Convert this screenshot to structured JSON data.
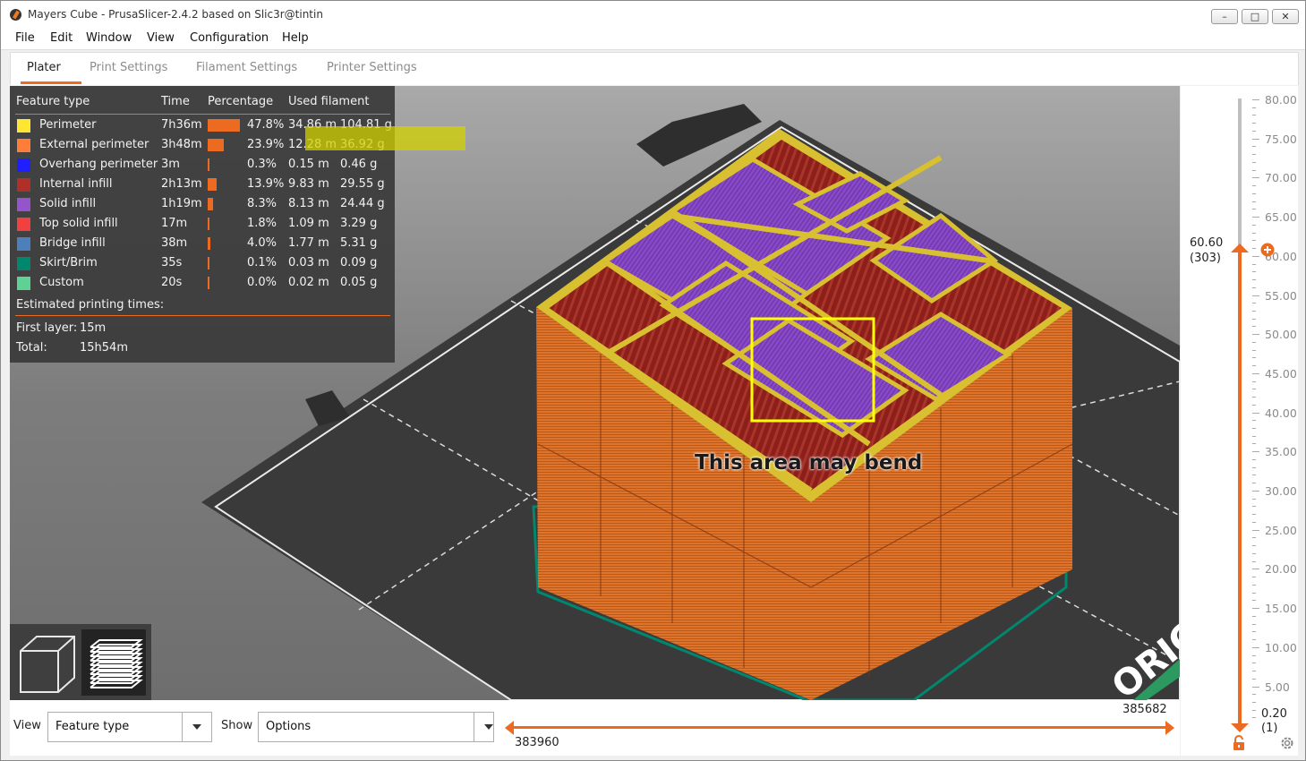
{
  "window": {
    "title": "Mayers Cube - PrusaSlicer-2.4.2 based on Slic3r@tintin",
    "minimize_glyph": "–",
    "maximize_glyph": "□",
    "close_glyph": "✕"
  },
  "menu": [
    "File",
    "Edit",
    "Window",
    "View",
    "Configuration",
    "Help"
  ],
  "tabs": [
    "Plater",
    "Print Settings",
    "Filament Settings",
    "Printer Settings"
  ],
  "legend": {
    "headers": [
      "Feature type",
      "Time",
      "Percentage",
      "Used filament"
    ],
    "rows": [
      {
        "name": "Perimeter",
        "color": "#ffe633",
        "time": "7h36m",
        "pct": "47.8%",
        "pct_value": 47.8,
        "len": "34.86 m",
        "weight": "104.81 g"
      },
      {
        "name": "External perimeter",
        "color": "#ff7d38",
        "time": "3h48m",
        "pct": "23.9%",
        "pct_value": 23.9,
        "len": "12.28 m",
        "weight": "36.92 g"
      },
      {
        "name": "Overhang perimeter",
        "color": "#1f1fff",
        "time": "3m",
        "pct": "0.3%",
        "pct_value": 0.3,
        "len": "0.15 m",
        "weight": "0.46 g"
      },
      {
        "name": "Internal infill",
        "color": "#b03029",
        "time": "2h13m",
        "pct": "13.9%",
        "pct_value": 13.9,
        "len": "9.83 m",
        "weight": "29.55 g"
      },
      {
        "name": "Solid infill",
        "color": "#9654cc",
        "time": "1h19m",
        "pct": "8.3%",
        "pct_value": 8.3,
        "len": "8.13 m",
        "weight": "24.44 g"
      },
      {
        "name": "Top solid infill",
        "color": "#f04040",
        "time": "17m",
        "pct": "1.8%",
        "pct_value": 1.8,
        "len": "1.09 m",
        "weight": "3.29 g"
      },
      {
        "name": "Bridge infill",
        "color": "#4d80ba",
        "time": "38m",
        "pct": "4.0%",
        "pct_value": 4.0,
        "len": "1.77 m",
        "weight": "5.31 g"
      },
      {
        "name": "Skirt/Brim",
        "color": "#00876e",
        "time": "35s",
        "pct": "0.1%",
        "pct_value": 0.1,
        "len": "0.03 m",
        "weight": "0.09 g"
      },
      {
        "name": "Custom",
        "color": "#5ed194",
        "time": "20s",
        "pct": "0.0%",
        "pct_value": 0.0,
        "len": "0.02 m",
        "weight": "0.05 g"
      }
    ],
    "estimated_label": "Estimated printing times:",
    "first_layer_label": "First layer:",
    "first_layer_value": "15m",
    "total_label": "Total:",
    "total_value": "15h54m"
  },
  "annotation": "This area may bend",
  "colors": {
    "accent": "#ed6b21",
    "highlight": "#ffff00",
    "bed": "#3c3c3c",
    "cube_side": "#e0732a",
    "solid_infill": "#8a4ac8",
    "perimeter": "#d8c030",
    "internal_infill": "#8c1f1a"
  },
  "vslider": {
    "ticks": [
      "80.00",
      "75.00",
      "70.00",
      "65.00",
      "60.00",
      "55.00",
      "50.00",
      "45.00",
      "40.00",
      "35.00",
      "30.00",
      "25.00",
      "20.00",
      "15.00",
      "10.00",
      "5.00"
    ],
    "current_height": "60.60",
    "current_layer": "(303)",
    "bottom_height": "0.20",
    "bottom_layer": "(1)"
  },
  "bottom": {
    "view_label": "View",
    "view_value": "Feature type",
    "show_label": "Show",
    "show_value": "Options",
    "hslider_upper": "385682",
    "hslider_lower": "383960"
  },
  "bed_logo": "ORIGIN"
}
